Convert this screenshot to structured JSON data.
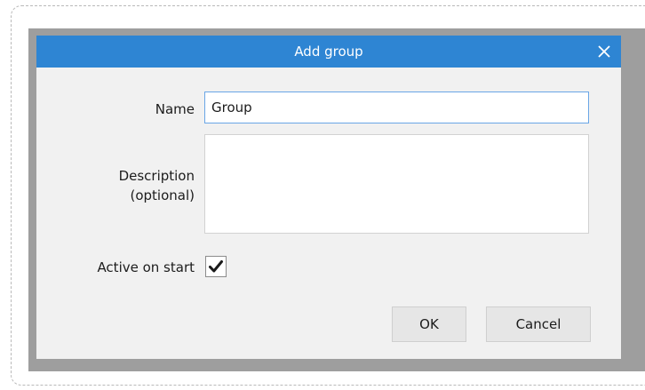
{
  "dialog": {
    "title": "Add group",
    "close_icon": "close-icon",
    "colors": {
      "titlebar": "#2e85d3",
      "backdrop": "#9e9e9e",
      "body": "#f1f1f1"
    }
  },
  "form": {
    "name_label": "Name",
    "name_value": "Group",
    "description_label_line1": "Description",
    "description_label_line2": "(optional)",
    "description_value": "",
    "active_label": "Active on start",
    "active_checked": true,
    "check_icon": "checkmark-icon"
  },
  "buttons": {
    "ok_label": "OK",
    "cancel_label": "Cancel"
  }
}
